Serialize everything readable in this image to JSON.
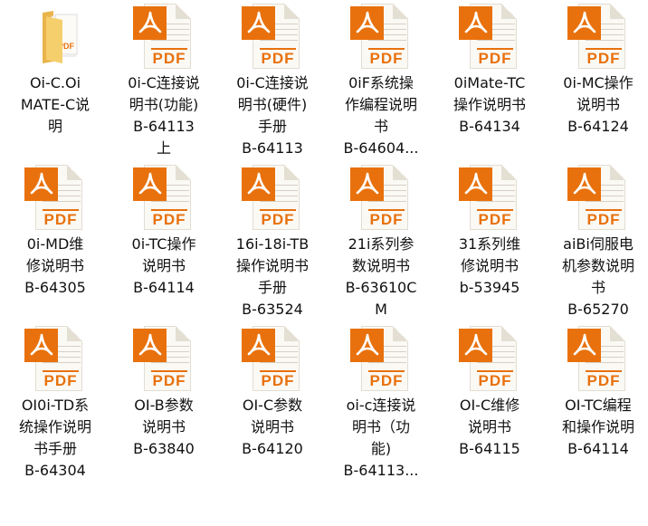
{
  "colors": {
    "pdf_accent": "#e8710d",
    "folder": "#f3c55a"
  },
  "files": [
    {
      "type": "folder",
      "icon": "folder-icon",
      "lines": [
        "Oi-C.Oi",
        "MATE-C说",
        "明"
      ]
    },
    {
      "type": "pdf",
      "icon": "pdf-icon",
      "lines": [
        "0i-C连接说",
        "明书(功能)",
        "B-64113",
        "上"
      ]
    },
    {
      "type": "pdf",
      "icon": "pdf-icon",
      "lines": [
        "0i-C连接说",
        "明书(硬件)",
        "手册",
        "B-64113"
      ]
    },
    {
      "type": "pdf",
      "icon": "pdf-icon",
      "lines": [
        "0iF系统操",
        "作编程说明",
        "书",
        "B-64604..."
      ]
    },
    {
      "type": "pdf",
      "icon": "pdf-icon",
      "lines": [
        "0iMate-TC",
        "操作说明书",
        "B-64134"
      ]
    },
    {
      "type": "pdf",
      "icon": "pdf-icon",
      "lines": [
        "0i-MC操作",
        "说明书",
        "B-64124"
      ]
    },
    {
      "type": "pdf",
      "icon": "pdf-icon",
      "lines": [
        "0i-MD维",
        "修说明书",
        "B-64305"
      ]
    },
    {
      "type": "pdf",
      "icon": "pdf-icon",
      "lines": [
        "0i-TC操作",
        "说明书",
        "B-64114"
      ]
    },
    {
      "type": "pdf",
      "icon": "pdf-icon",
      "lines": [
        "16i-18i-TB",
        "操作说明书",
        "手册",
        "B-63524"
      ]
    },
    {
      "type": "pdf",
      "icon": "pdf-icon",
      "lines": [
        "21i系列参",
        "数说明书",
        "B-63610C",
        "M"
      ]
    },
    {
      "type": "pdf",
      "icon": "pdf-icon",
      "lines": [
        "31系列维",
        "修说明书",
        "b-53945"
      ]
    },
    {
      "type": "pdf",
      "icon": "pdf-icon",
      "lines": [
        "aiBi伺服电",
        "机参数说明",
        "书",
        "B-65270"
      ]
    },
    {
      "type": "pdf",
      "icon": "pdf-icon",
      "lines": [
        "OI0i-TD系",
        "统操作说明",
        "书手册",
        "B-64304"
      ]
    },
    {
      "type": "pdf",
      "icon": "pdf-icon",
      "lines": [
        "OI-B参数",
        "说明书",
        "B-63840"
      ]
    },
    {
      "type": "pdf",
      "icon": "pdf-icon",
      "lines": [
        "OI-C参数",
        "说明书",
        "B-64120"
      ]
    },
    {
      "type": "pdf",
      "icon": "pdf-icon",
      "lines": [
        "oi-c连接说",
        "明书（功",
        "能)",
        "B-64113..."
      ]
    },
    {
      "type": "pdf",
      "icon": "pdf-icon",
      "lines": [
        "OI-C维修",
        "说明书",
        "B-64115"
      ]
    },
    {
      "type": "pdf",
      "icon": "pdf-icon",
      "lines": [
        "OI-TC编程",
        "和操作说明",
        "B-64114"
      ]
    }
  ],
  "pdf_text": "PDF"
}
